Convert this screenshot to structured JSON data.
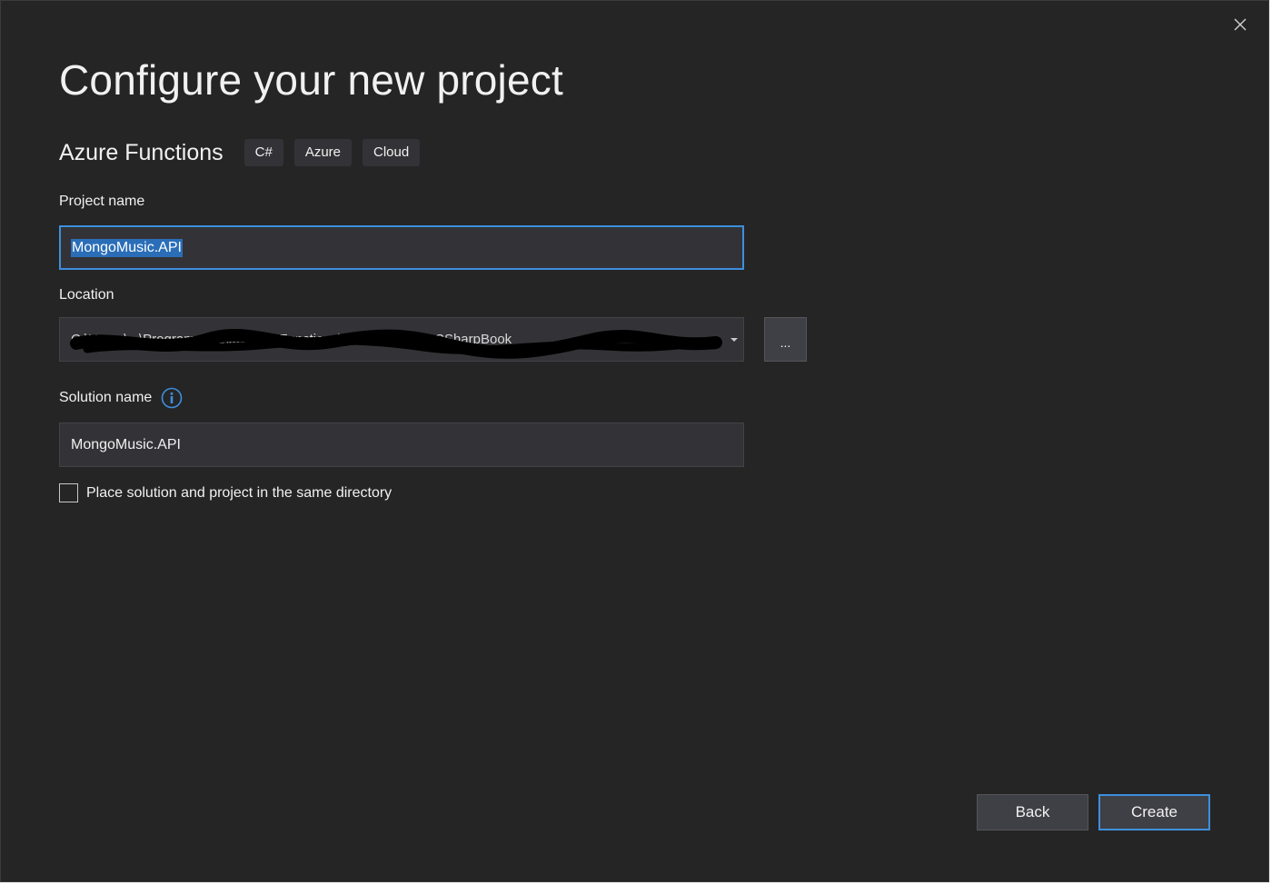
{
  "dialog": {
    "title": "Configure your new project"
  },
  "template": {
    "name": "Azure Functions",
    "tags": [
      "C#",
      "Azure",
      "Cloud"
    ]
  },
  "project_name": {
    "label": "Project name",
    "value": "MongoMusic.API"
  },
  "location": {
    "label": "Location",
    "value": "C:\\Users\\...\\Programming\\...\\AzureFunctions\\...\\MongoMusicCSharpBook",
    "browse_label": "..."
  },
  "solution_name": {
    "label": "Solution name",
    "value": "MongoMusic.API"
  },
  "same_directory": {
    "label": "Place solution and project in the same directory",
    "checked": false
  },
  "buttons": {
    "back": "Back",
    "create": "Create"
  },
  "icons": {
    "close": "close-icon",
    "info": "info-icon",
    "dropdown": "chevron-down-icon"
  },
  "colors": {
    "background": "#252526",
    "accent": "#3e8fdc",
    "selection": "#2a6eb8",
    "info_icon": "#3e8fdc"
  }
}
